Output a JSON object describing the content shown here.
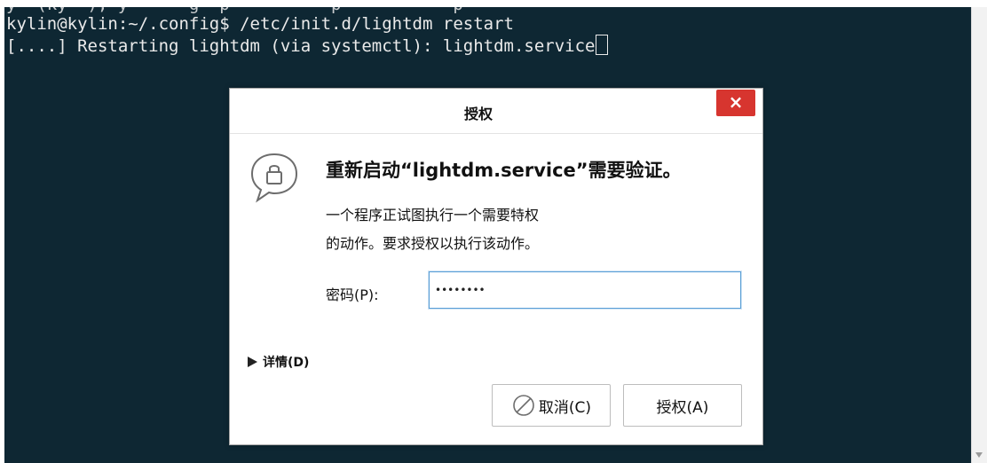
{
  "terminal": {
    "lines": [
      "y  (ky  ), y      g  p          p           p",
      "kylin@kylin:~/.config$ /etc/init.d/lightdm restart",
      "[....] Restarting lightdm (via systemctl): lightdm.service"
    ]
  },
  "dialog": {
    "title": "授权",
    "close_label": "×",
    "heading": "重新启动“lightdm.service”需要验证。",
    "description_line1": "一个程序正试图执行一个需要特权",
    "description_line2": "的动作。要求授权以执行该动作。",
    "password_label": "密码(P):",
    "password_value": "••••••••",
    "details_label": "详情(D)",
    "cancel_label": "取消(C)",
    "authorize_label": "授权(A)"
  },
  "colors": {
    "terminal_bg": "#0e2733",
    "close_button": "#d7352f",
    "input_focus": "#5a9fd6"
  },
  "icons": {
    "dialog": "speech-bubble-lock-icon",
    "cancel": "circle-slash-icon",
    "details": "triangle-right-icon"
  }
}
